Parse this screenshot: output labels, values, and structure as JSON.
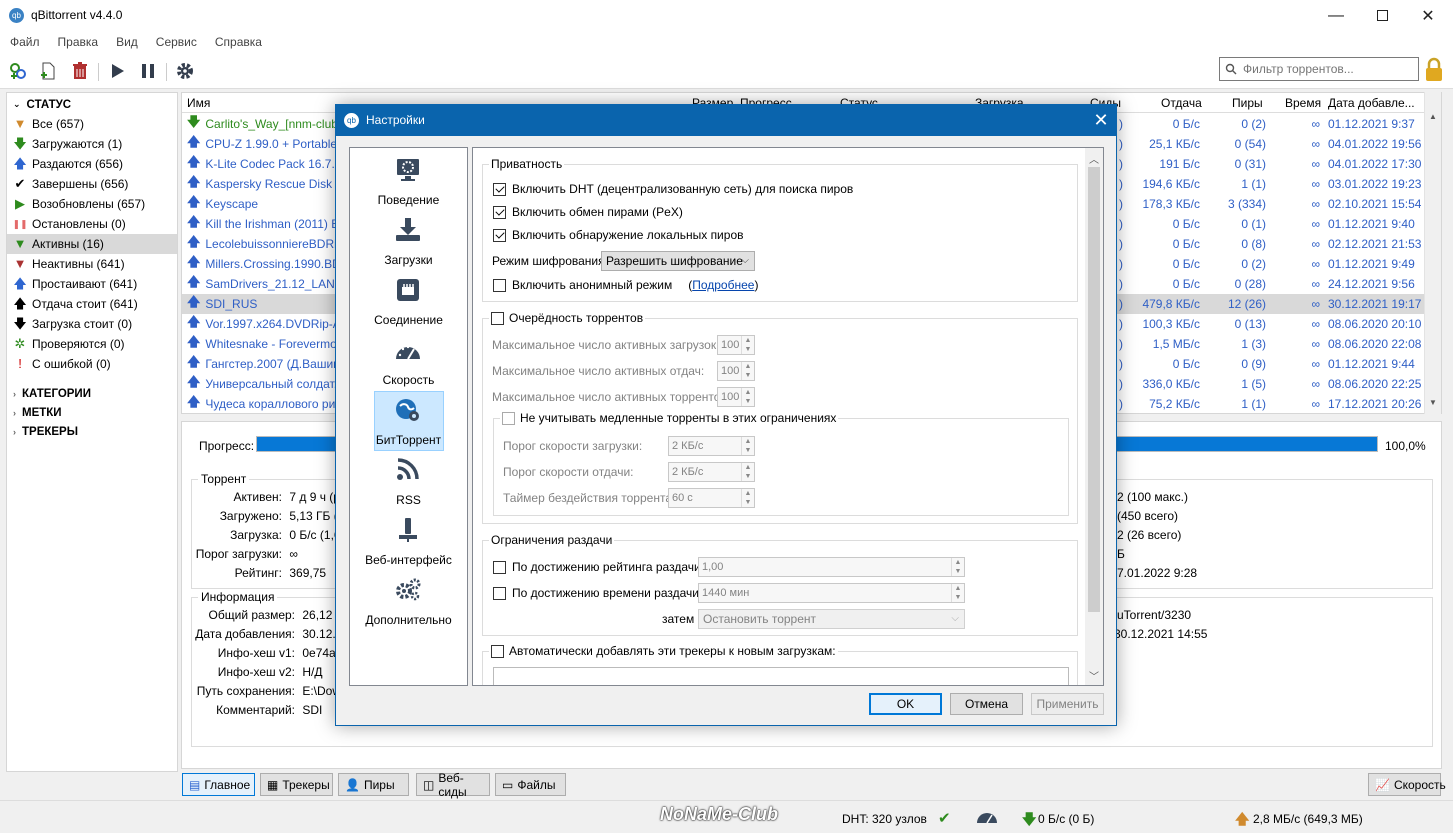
{
  "window": {
    "title": "qBittorrent v4.4.0",
    "logo": "qb"
  },
  "menu": [
    "Файл",
    "Правка",
    "Вид",
    "Сервис",
    "Справка"
  ],
  "toolbar": {
    "filter_placeholder": "Фильтр торрентов..."
  },
  "sidebar": {
    "status_header": "СТАТУС",
    "status_items": [
      {
        "label": "Все (657)",
        "icon": "filter-icon",
        "color": "#d08a2e"
      },
      {
        "label": "Загружаются (1)",
        "icon": "download-arrow-icon",
        "color": "#2e8b1e"
      },
      {
        "label": "Раздаются (656)",
        "icon": "upload-arrow-icon",
        "color": "#2f66d0"
      },
      {
        "label": "Завершены (656)",
        "icon": "checkmark-icon",
        "color": "#000000"
      },
      {
        "label": "Возобновлены (657)",
        "icon": "play-icon",
        "color": "#2e8b1e"
      },
      {
        "label": "Остановлены (0)",
        "icon": "pause-icon",
        "color": "#e36a6a"
      },
      {
        "label": "Активны (16)",
        "icon": "filter-icon",
        "color": "#2e8b1e"
      },
      {
        "label": "Неактивны (641)",
        "icon": "filter-icon",
        "color": "#a33"
      },
      {
        "label": "Простаивают (641)",
        "icon": "upload-arrow-icon",
        "color": "#2f66d0"
      },
      {
        "label": "Отдача стоит (641)",
        "icon": "upload-arrow-icon",
        "color": "#000000"
      },
      {
        "label": "Загрузка стоит (0)",
        "icon": "download-arrow-icon",
        "color": "#000000"
      },
      {
        "label": "Проверяются (0)",
        "icon": "gear-icon",
        "color": "#2e8b1e"
      },
      {
        "label": "С ошибкой (0)",
        "icon": "error-icon",
        "color": "#cc0000"
      }
    ],
    "categories_header": "КАТЕГОРИИ",
    "tags_header": "МЕТКИ",
    "trackers_header": "ТРЕКЕРЫ"
  },
  "list": {
    "columns": {
      "name": "Имя",
      "size": "Размер",
      "progress": "Прогресс",
      "status": "Статус",
      "download": "Загрузка",
      "seeds": "Сиды",
      "upload": "Отдача",
      "peers": "Пиры",
      "eta": "Время",
      "added": "Дата добавле..."
    },
    "rows": [
      {
        "name": "Carlito's_Way_[nnm-club",
        "dir": "down",
        "seed": ")",
        "upload": "0 Б/с",
        "peers": "0 (2)",
        "eta": "∞",
        "added": "01.12.2021 9:37"
      },
      {
        "name": "CPU-Z 1.99.0 + Portable",
        "dir": "up",
        "seed": ")",
        "upload": "25,1 КБ/с",
        "peers": "0 (54)",
        "eta": "∞",
        "added": "04.01.2022 19:56"
      },
      {
        "name": "K-Lite Codec Pack 16.7.0",
        "dir": "up",
        "seed": ")",
        "upload": "191 Б/с",
        "peers": "0 (31)",
        "eta": "∞",
        "added": "04.01.2022 17:30"
      },
      {
        "name": "Kaspersky Rescue Disk 20",
        "dir": "up",
        "seed": ")",
        "upload": "194,6 КБ/с",
        "peers": "1 (1)",
        "eta": "∞",
        "added": "03.01.2022 19:23"
      },
      {
        "name": "Keyscape",
        "dir": "up",
        "seed": ")",
        "upload": "178,3 КБ/с",
        "peers": "3 (334)",
        "eta": "∞",
        "added": "02.10.2021 15:54"
      },
      {
        "name": "Kill the Irishman (2011) BD",
        "dir": "up",
        "seed": ")",
        "upload": "0 Б/с",
        "peers": "0 (1)",
        "eta": "∞",
        "added": "01.12.2021 9:40"
      },
      {
        "name": "LecolebuissonniereBDRip",
        "dir": "up",
        "seed": ")",
        "upload": "0 Б/с",
        "peers": "0 (8)",
        "eta": "∞",
        "added": "02.12.2021 21:53"
      },
      {
        "name": "Millers.Crossing.1990.BDr",
        "dir": "up",
        "seed": ")",
        "upload": "0 Б/с",
        "peers": "0 (2)",
        "eta": "∞",
        "added": "01.12.2021 9:49"
      },
      {
        "name": "SamDrivers_21.12_LAN.ex",
        "dir": "up",
        "seed": ")",
        "upload": "0 Б/с",
        "peers": "0 (28)",
        "eta": "∞",
        "added": "24.12.2021 9:56"
      },
      {
        "name": "SDI_RUS",
        "dir": "up",
        "seed": ")",
        "upload": "479,8 КБ/с",
        "peers": "12 (26)",
        "eta": "∞",
        "added": "30.12.2021 19:17",
        "selected": true
      },
      {
        "name": "Vor.1997.x264.DVDRip-AV",
        "dir": "up",
        "seed": ")",
        "upload": "100,3 КБ/с",
        "peers": "0 (13)",
        "eta": "∞",
        "added": "08.06.2020 20:10"
      },
      {
        "name": "Whitesnake - Forevermor",
        "dir": "up",
        "seed": ")",
        "upload": "1,5 МБ/с",
        "peers": "1 (3)",
        "eta": "∞",
        "added": "08.06.2020 22:08"
      },
      {
        "name": "Гангстер.2007 (Д.Вашин",
        "dir": "up",
        "seed": ")",
        "upload": "0 Б/с",
        "peers": "0 (9)",
        "eta": "∞",
        "added": "01.12.2021 9:44"
      },
      {
        "name": "Универсальный солдат.",
        "dir": "up",
        "seed": ")",
        "upload": "336,0 КБ/с",
        "peers": "1 (5)",
        "eta": "∞",
        "added": "08.06.2020 22:25"
      },
      {
        "name": "Чудеса кораллового риф",
        "dir": "up",
        "seed": ")",
        "upload": "75,2 КБ/с",
        "peers": "1 (1)",
        "eta": "∞",
        "added": "17.12.2021 20:26"
      }
    ]
  },
  "details": {
    "progress_label": "Прогресс:",
    "progress_value": "100,0%",
    "progress_fraction": 1.0,
    "torrent_group": "Торрент",
    "torrent_fields": [
      {
        "k": "Активен:",
        "v": "7 д 9 ч (р"
      },
      {
        "k": "Загружено:",
        "v": "5,13 ГБ ("
      },
      {
        "k": "Загрузка:",
        "v": "0 Б/с (1,6"
      },
      {
        "k": "Порог загрузки:",
        "v": "∞"
      },
      {
        "k": "Рейтинг:",
        "v": "369,75"
      }
    ],
    "torrent_right": [
      "2 (100 макс.)",
      "(450 всего)",
      "2 (26 всего)",
      "Б",
      "7.01.2022 9:28"
    ],
    "info_group": "Информация",
    "info_fields": [
      {
        "k": "Общий размер:",
        "v": "26,12 Г"
      },
      {
        "k": "Дата добавления:",
        "v": "30.12.2"
      },
      {
        "k": "Инфо-хеш v1:",
        "v": "0e74a4"
      },
      {
        "k": "Инфо-хеш v2:",
        "v": "Н/Д"
      },
      {
        "k": "Путь сохранения:",
        "v": "E:\\Dow"
      },
      {
        "k": "Комментарий:",
        "v": "SDI"
      }
    ],
    "info_right": [
      "uTorrent/3230",
      "30.12.2021 14:55"
    ]
  },
  "bottom_tabs": [
    "Главное",
    "Трекеры",
    "Пиры",
    "Веб-сиды",
    "Файлы"
  ],
  "speed_button": "Скорость",
  "status": {
    "watermark": "NoNaMe-Club",
    "dht": "DHT: 320 узлов",
    "download": "0 Б/с (0 Б)",
    "upload": "2,8 МБ/с (649,3 МБ)"
  },
  "dialog": {
    "title": "Настройки",
    "categories": [
      "Поведение",
      "Загрузки",
      "Соединение",
      "Скорость",
      "БитТоррент",
      "RSS",
      "Веб-интерфейс",
      "Дополнительно"
    ],
    "privacy": {
      "title": "Приватность",
      "dht": "Включить DHT (децентрализованную сеть) для поиска пиров",
      "pex": "Включить обмен пирами (PeX)",
      "lsd": "Включить обнаружение локальных пиров",
      "enc_label": "Режим шифрования:",
      "enc_value": "Разрешить шифрование",
      "anon": "Включить анонимный режим",
      "more": "Подробнее"
    },
    "queue": {
      "title": "Очерёдность торрентов",
      "max_dl": "Максимальное число активных загрузок:",
      "max_ul": "Максимальное число активных отдач:",
      "max_t": "Максимальное число активных торрентов:",
      "val_dl": "100",
      "val_ul": "100",
      "val_t": "100",
      "slow": "Не учитывать медленные торренты в этих ограничениях",
      "dl_thr": "Порог скорости загрузки:",
      "ul_thr": "Порог скорости отдачи:",
      "idle": "Таймер бездействия торрента:",
      "dl_thr_v": "2 КБ/с",
      "ul_thr_v": "2 КБ/с",
      "idle_v": "60 с"
    },
    "seeding": {
      "title": "Ограничения раздачи",
      "ratio": "По достижению рейтинга раздачи",
      "ratio_v": "1,00",
      "time": "По достижению времени раздачи",
      "time_v": "1440 мин",
      "then": "затем",
      "then_v": "Остановить торрент"
    },
    "trackers": {
      "title": "Автоматически добавлять эти трекеры к новым загрузкам:"
    },
    "buttons": {
      "ok": "OK",
      "cancel": "Отмена",
      "apply": "Применить"
    }
  }
}
